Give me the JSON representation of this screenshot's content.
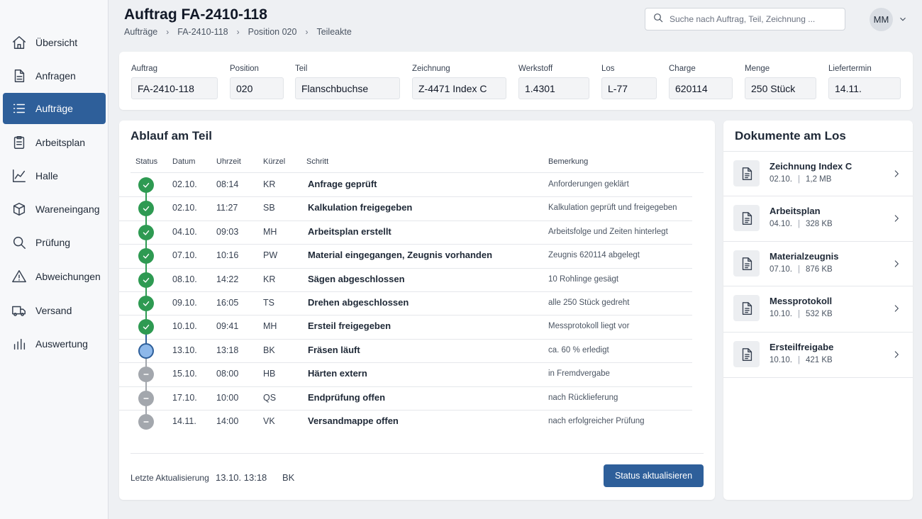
{
  "sidebar": {
    "items": [
      {
        "label": "Übersicht",
        "icon": "home-icon"
      },
      {
        "label": "Anfragen",
        "icon": "document-icon"
      },
      {
        "label": "Aufträge",
        "icon": "list-icon",
        "active": true
      },
      {
        "label": "Arbeitsplan",
        "icon": "clipboard-icon"
      },
      {
        "label": "Halle",
        "icon": "chart-line-icon"
      },
      {
        "label": "Wareneingang",
        "icon": "box-icon"
      },
      {
        "label": "Prüfung",
        "icon": "search-icon"
      },
      {
        "label": "Abweichungen",
        "icon": "warning-icon"
      },
      {
        "label": "Versand",
        "icon": "truck-icon"
      },
      {
        "label": "Auswertung",
        "icon": "bar-chart-icon"
      }
    ]
  },
  "header": {
    "title": "Auftrag FA-2410-118",
    "breadcrumb": [
      "Aufträge",
      "FA-2410-118",
      "Position 020",
      "Teileakte"
    ],
    "search_placeholder": "Suche nach Auftrag, Teil, Zeichnung ...",
    "user_initials": "MM"
  },
  "info": {
    "fields": [
      {
        "label": "Auftrag",
        "value": "FA-2410-118"
      },
      {
        "label": "Position",
        "value": "020"
      },
      {
        "label": "Teil",
        "value": "Flanschbuchse"
      },
      {
        "label": "Zeichnung",
        "value": "Z-4471 Index C"
      },
      {
        "label": "Werkstoff",
        "value": "1.4301"
      },
      {
        "label": "Los",
        "value": "L-77"
      },
      {
        "label": "Charge",
        "value": "620114"
      },
      {
        "label": "Menge",
        "value": "250 Stück"
      },
      {
        "label": "Liefertermin",
        "value": "14.11."
      }
    ]
  },
  "timeline": {
    "title": "Ablauf am Teil",
    "columns": [
      "Status",
      "Datum",
      "Uhrzeit",
      "Kürzel",
      "Schritt",
      "Bemerkung"
    ],
    "rows": [
      {
        "status": "done",
        "date": "02.10.",
        "time": "08:14",
        "user": "KR",
        "step": "Anfrage geprüft",
        "note": "Anforderungen geklärt"
      },
      {
        "status": "done",
        "date": "02.10.",
        "time": "11:27",
        "user": "SB",
        "step": "Kalkulation freigegeben",
        "note": "Kalkulation geprüft und freigegeben"
      },
      {
        "status": "done",
        "date": "04.10.",
        "time": "09:03",
        "user": "MH",
        "step": "Arbeitsplan erstellt",
        "note": "Arbeitsfolge und Zeiten hinterlegt"
      },
      {
        "status": "done",
        "date": "07.10.",
        "time": "10:16",
        "user": "PW",
        "step": "Material eingegangen, Zeugnis vorhanden",
        "note": "Zeugnis 620114 abgelegt"
      },
      {
        "status": "done",
        "date": "08.10.",
        "time": "14:22",
        "user": "KR",
        "step": "Sägen abgeschlossen",
        "note": "10 Rohlinge gesägt"
      },
      {
        "status": "done",
        "date": "09.10.",
        "time": "16:05",
        "user": "TS",
        "step": "Drehen abgeschlossen",
        "note": "alle 250 Stück gedreht"
      },
      {
        "status": "done",
        "date": "10.10.",
        "time": "09:41",
        "user": "MH",
        "step": "Ersteil freigegeben",
        "note": "Messprotokoll liegt vor"
      },
      {
        "status": "active",
        "date": "13.10.",
        "time": "13:18",
        "user": "BK",
        "step": "Fräsen läuft",
        "note": "ca. 60 % erledigt"
      },
      {
        "status": "pending",
        "date": "15.10.",
        "time": "08:00",
        "user": "HB",
        "step": "Härten extern",
        "note": "in Fremdvergabe"
      },
      {
        "status": "pending",
        "date": "17.10.",
        "time": "10:00",
        "user": "QS",
        "step": "Endprüfung offen",
        "note": "nach Rücklieferung"
      },
      {
        "status": "pending",
        "date": "14.11.",
        "time": "14:00",
        "user": "VK",
        "step": "Versandmappe offen",
        "note": "nach erfolgreicher Prüfung"
      }
    ],
    "footer": {
      "label": "Letzte Aktualisierung",
      "time": "13.10. 13:18",
      "user": "BK",
      "button": "Status aktualisieren"
    }
  },
  "documents": {
    "title": "Dokumente am Los",
    "items": [
      {
        "name": "Zeichnung Index C",
        "date": "02.10.",
        "size": "1,2 MB"
      },
      {
        "name": "Arbeitsplan",
        "date": "04.10.",
        "size": "328 KB"
      },
      {
        "name": "Materialzeugnis",
        "date": "07.10.",
        "size": "876 KB"
      },
      {
        "name": "Messprotokoll",
        "date": "10.10.",
        "size": "532 KB"
      },
      {
        "name": "Ersteilfreigabe",
        "date": "10.10.",
        "size": "421 KB"
      }
    ]
  },
  "colors": {
    "accent": "#2e5f9a",
    "done": "#2e9a52",
    "active": "#8db8ea",
    "pending": "#a3a7ad"
  }
}
